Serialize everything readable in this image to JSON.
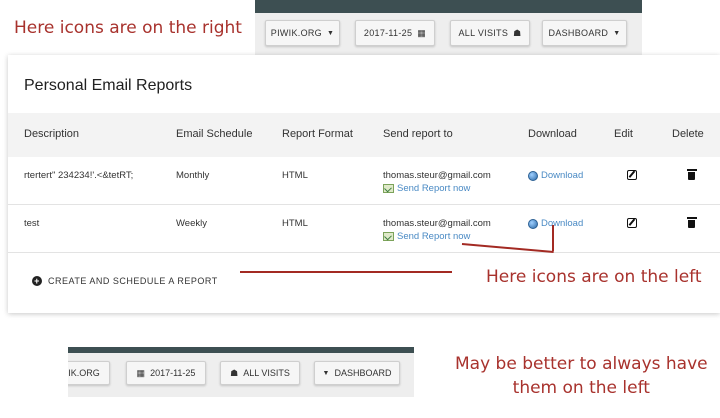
{
  "annotations": {
    "top": "Here icons are on the right",
    "middle": "Here icons are on the left",
    "bottom_line1": "May be better to always have",
    "bottom_line2": "them on the left"
  },
  "top_toolbar": {
    "site": "PIWIK.ORG",
    "date": "2017-11-25",
    "segment": "ALL VISITS",
    "dashboard": "DASHBOARD"
  },
  "bottom_toolbar": {
    "site": "IK.ORG",
    "date": "2017-11-25",
    "segment": "ALL VISITS",
    "dashboard": "DASHBOARD"
  },
  "report": {
    "title": "Personal Email Reports",
    "columns": [
      "Description",
      "Email Schedule",
      "Report Format",
      "Send report to",
      "Download",
      "Edit",
      "Delete"
    ],
    "rows": [
      {
        "description": "rtertert\" 234234!'.<&tetRT;",
        "schedule": "Monthly",
        "format": "HTML",
        "email": "thomas.steur@gmail.com",
        "send_label": "Send Report now",
        "download_label": "Download"
      },
      {
        "description": "test",
        "schedule": "Weekly",
        "format": "HTML",
        "email": "thomas.steur@gmail.com",
        "send_label": "Send Report now",
        "download_label": "Download"
      }
    ],
    "create_label": "CREATE AND SCHEDULE A REPORT"
  },
  "colors": {
    "annotation_red": "#a8322d",
    "link_blue": "#4a8ac4",
    "toolbar_dark": "#3d4f52"
  },
  "icons": {
    "dropdown": "caret-down-icon",
    "calendar": "calendar-icon",
    "segment": "users-icon",
    "download": "globe-download-icon",
    "send": "send-report-icon",
    "edit": "edit-icon",
    "delete": "trash-icon",
    "create": "plus-circle-icon"
  }
}
